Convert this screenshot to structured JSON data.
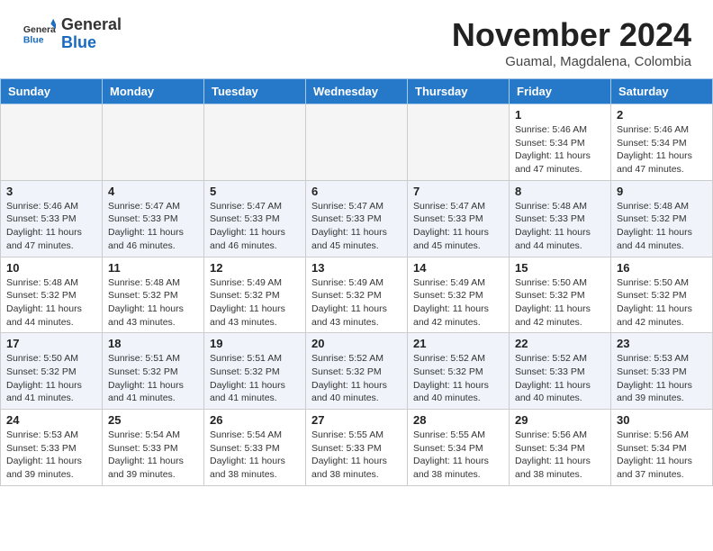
{
  "header": {
    "logo_general": "General",
    "logo_blue": "Blue",
    "month_year": "November 2024",
    "location": "Guamal, Magdalena, Colombia"
  },
  "days_of_week": [
    "Sunday",
    "Monday",
    "Tuesday",
    "Wednesday",
    "Thursday",
    "Friday",
    "Saturday"
  ],
  "weeks": [
    {
      "days": [
        {
          "number": "",
          "info": ""
        },
        {
          "number": "",
          "info": ""
        },
        {
          "number": "",
          "info": ""
        },
        {
          "number": "",
          "info": ""
        },
        {
          "number": "",
          "info": ""
        },
        {
          "number": "1",
          "info": "Sunrise: 5:46 AM\nSunset: 5:34 PM\nDaylight: 11 hours and 47 minutes."
        },
        {
          "number": "2",
          "info": "Sunrise: 5:46 AM\nSunset: 5:34 PM\nDaylight: 11 hours and 47 minutes."
        }
      ]
    },
    {
      "days": [
        {
          "number": "3",
          "info": "Sunrise: 5:46 AM\nSunset: 5:33 PM\nDaylight: 11 hours and 47 minutes."
        },
        {
          "number": "4",
          "info": "Sunrise: 5:47 AM\nSunset: 5:33 PM\nDaylight: 11 hours and 46 minutes."
        },
        {
          "number": "5",
          "info": "Sunrise: 5:47 AM\nSunset: 5:33 PM\nDaylight: 11 hours and 46 minutes."
        },
        {
          "number": "6",
          "info": "Sunrise: 5:47 AM\nSunset: 5:33 PM\nDaylight: 11 hours and 45 minutes."
        },
        {
          "number": "7",
          "info": "Sunrise: 5:47 AM\nSunset: 5:33 PM\nDaylight: 11 hours and 45 minutes."
        },
        {
          "number": "8",
          "info": "Sunrise: 5:48 AM\nSunset: 5:33 PM\nDaylight: 11 hours and 44 minutes."
        },
        {
          "number": "9",
          "info": "Sunrise: 5:48 AM\nSunset: 5:32 PM\nDaylight: 11 hours and 44 minutes."
        }
      ]
    },
    {
      "days": [
        {
          "number": "10",
          "info": "Sunrise: 5:48 AM\nSunset: 5:32 PM\nDaylight: 11 hours and 44 minutes."
        },
        {
          "number": "11",
          "info": "Sunrise: 5:48 AM\nSunset: 5:32 PM\nDaylight: 11 hours and 43 minutes."
        },
        {
          "number": "12",
          "info": "Sunrise: 5:49 AM\nSunset: 5:32 PM\nDaylight: 11 hours and 43 minutes."
        },
        {
          "number": "13",
          "info": "Sunrise: 5:49 AM\nSunset: 5:32 PM\nDaylight: 11 hours and 43 minutes."
        },
        {
          "number": "14",
          "info": "Sunrise: 5:49 AM\nSunset: 5:32 PM\nDaylight: 11 hours and 42 minutes."
        },
        {
          "number": "15",
          "info": "Sunrise: 5:50 AM\nSunset: 5:32 PM\nDaylight: 11 hours and 42 minutes."
        },
        {
          "number": "16",
          "info": "Sunrise: 5:50 AM\nSunset: 5:32 PM\nDaylight: 11 hours and 42 minutes."
        }
      ]
    },
    {
      "days": [
        {
          "number": "17",
          "info": "Sunrise: 5:50 AM\nSunset: 5:32 PM\nDaylight: 11 hours and 41 minutes."
        },
        {
          "number": "18",
          "info": "Sunrise: 5:51 AM\nSunset: 5:32 PM\nDaylight: 11 hours and 41 minutes."
        },
        {
          "number": "19",
          "info": "Sunrise: 5:51 AM\nSunset: 5:32 PM\nDaylight: 11 hours and 41 minutes."
        },
        {
          "number": "20",
          "info": "Sunrise: 5:52 AM\nSunset: 5:32 PM\nDaylight: 11 hours and 40 minutes."
        },
        {
          "number": "21",
          "info": "Sunrise: 5:52 AM\nSunset: 5:32 PM\nDaylight: 11 hours and 40 minutes."
        },
        {
          "number": "22",
          "info": "Sunrise: 5:52 AM\nSunset: 5:33 PM\nDaylight: 11 hours and 40 minutes."
        },
        {
          "number": "23",
          "info": "Sunrise: 5:53 AM\nSunset: 5:33 PM\nDaylight: 11 hours and 39 minutes."
        }
      ]
    },
    {
      "days": [
        {
          "number": "24",
          "info": "Sunrise: 5:53 AM\nSunset: 5:33 PM\nDaylight: 11 hours and 39 minutes."
        },
        {
          "number": "25",
          "info": "Sunrise: 5:54 AM\nSunset: 5:33 PM\nDaylight: 11 hours and 39 minutes."
        },
        {
          "number": "26",
          "info": "Sunrise: 5:54 AM\nSunset: 5:33 PM\nDaylight: 11 hours and 38 minutes."
        },
        {
          "number": "27",
          "info": "Sunrise: 5:55 AM\nSunset: 5:33 PM\nDaylight: 11 hours and 38 minutes."
        },
        {
          "number": "28",
          "info": "Sunrise: 5:55 AM\nSunset: 5:34 PM\nDaylight: 11 hours and 38 minutes."
        },
        {
          "number": "29",
          "info": "Sunrise: 5:56 AM\nSunset: 5:34 PM\nDaylight: 11 hours and 38 minutes."
        },
        {
          "number": "30",
          "info": "Sunrise: 5:56 AM\nSunset: 5:34 PM\nDaylight: 11 hours and 37 minutes."
        }
      ]
    }
  ]
}
